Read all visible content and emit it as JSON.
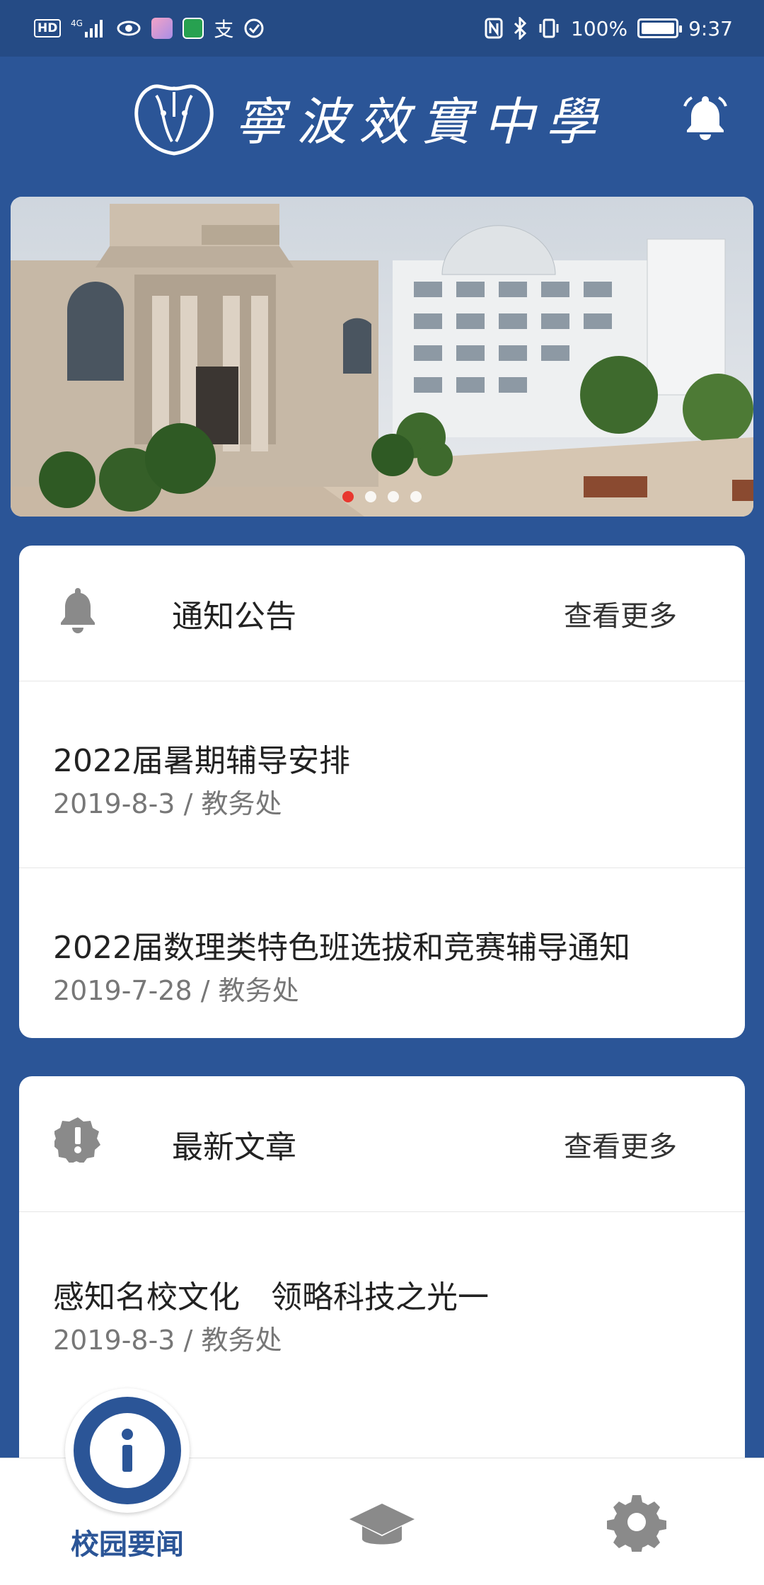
{
  "status_bar": {
    "hd": "HD",
    "network": "4G",
    "alipay_glyph": "支",
    "battery_percent": "100%",
    "time": "9:37"
  },
  "header": {
    "school_name": "寧波效實中學"
  },
  "banner": {
    "slide_count": 4,
    "active_index": 0
  },
  "notices": {
    "title": "通知公告",
    "more": "查看更多",
    "items": [
      {
        "title": "2022届暑期辅导安排",
        "meta": "2019-8-3 / 教务处"
      },
      {
        "title": "2022届数理类特色班选拔和竞赛辅导通知",
        "meta": "2019-7-28 / 教务处"
      }
    ]
  },
  "articles": {
    "title": "最新文章",
    "more": "查看更多",
    "items": [
      {
        "title": "感知名校文化　领略科技之光一",
        "meta": "2019-8-3 / 教务处"
      }
    ]
  },
  "bottom_nav": {
    "active_label": "校园要闻",
    "items": [
      {
        "icon": "info-icon",
        "label": "校园要闻",
        "active": true
      },
      {
        "icon": "graduation-cap-icon",
        "label": "",
        "active": false
      },
      {
        "icon": "gear-icon",
        "label": "",
        "active": false
      }
    ]
  },
  "colors": {
    "primary": "#2b5597",
    "status_bar": "#254b85",
    "active_dot": "#e8382f"
  }
}
